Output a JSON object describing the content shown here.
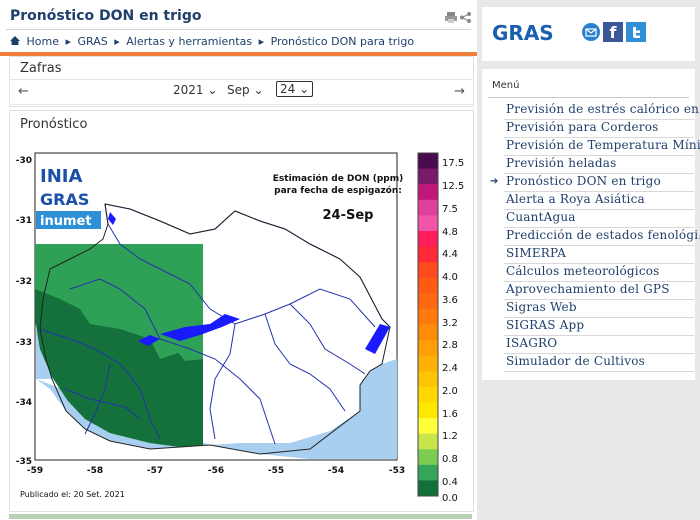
{
  "page": {
    "title": "Pronóstico DON en trigo",
    "tools_icons": [
      "print-icon",
      "share-icon"
    ]
  },
  "breadcrumb": [
    "Home",
    "GRAS",
    "Alertas y herramientas",
    "Pronóstico DON para trigo"
  ],
  "zafras": {
    "label": "Zafras",
    "year": "2021",
    "month": "Sep",
    "day": "24",
    "prev_arrow": "←",
    "next_arrow": "→"
  },
  "pronostico": {
    "label": "Pronóstico"
  },
  "map": {
    "heading_line1": "Estimación de DON (ppm)",
    "heading_line2": "para fecha de espigazón:",
    "date": "24-Sep",
    "published": "Publicado el: 20 Set. 2021",
    "logo_inia": "INIA",
    "logo_gras": "GRAS",
    "logo_inumet": "inumet",
    "y_ticks": [
      "-30",
      "-31",
      "-32",
      "-33",
      "-34",
      "-35"
    ],
    "x_ticks": [
      "-59",
      "-58",
      "-57",
      "-56",
      "-55",
      "-54",
      "-53"
    ],
    "scale_labels": [
      "17.5",
      "12.5",
      "7.5",
      "4.8",
      "4.4",
      "4.0",
      "3.6",
      "3.2",
      "2.8",
      "2.4",
      "2.0",
      "1.6",
      "1.2",
      "0.8",
      "0.4",
      "0.0"
    ],
    "scale_colors": [
      "#4a0a50",
      "#7a1a6a",
      "#c0187a",
      "#e0409a",
      "#f055a8",
      "#ff1e5a",
      "#ff2838",
      "#ff4a20",
      "#ff5a14",
      "#ff6810",
      "#ff7a0a",
      "#ff8c08",
      "#ff9e06",
      "#ffb004",
      "#ffc402",
      "#ffd800",
      "#ffe800",
      "#ffff3a",
      "#c8e64a",
      "#7ccb52",
      "#34a55a",
      "#12703a"
    ]
  },
  "sidebar": {
    "logo": "GRAS",
    "social_icons": [
      "email-icon",
      "facebook-icon",
      "twitter-icon"
    ],
    "menu_title": "Menú",
    "items": [
      "Previsión de estrés calórico en...",
      "Previsión para Corderos",
      "Previsión de Temperatura Míni...",
      "Previsión heladas",
      "Pronóstico DON en trigo",
      "Alerta a Roya Asiática",
      "CuantAgua",
      "Predicción de estados fenológi...",
      "SIMERPA",
      "Cálculos meteorológicos",
      "Aprovechamiento del GPS",
      "Sigras Web",
      "SIGRAS App",
      "ISAGRO",
      "Simulador de Cultivos"
    ],
    "active_index": 4
  }
}
